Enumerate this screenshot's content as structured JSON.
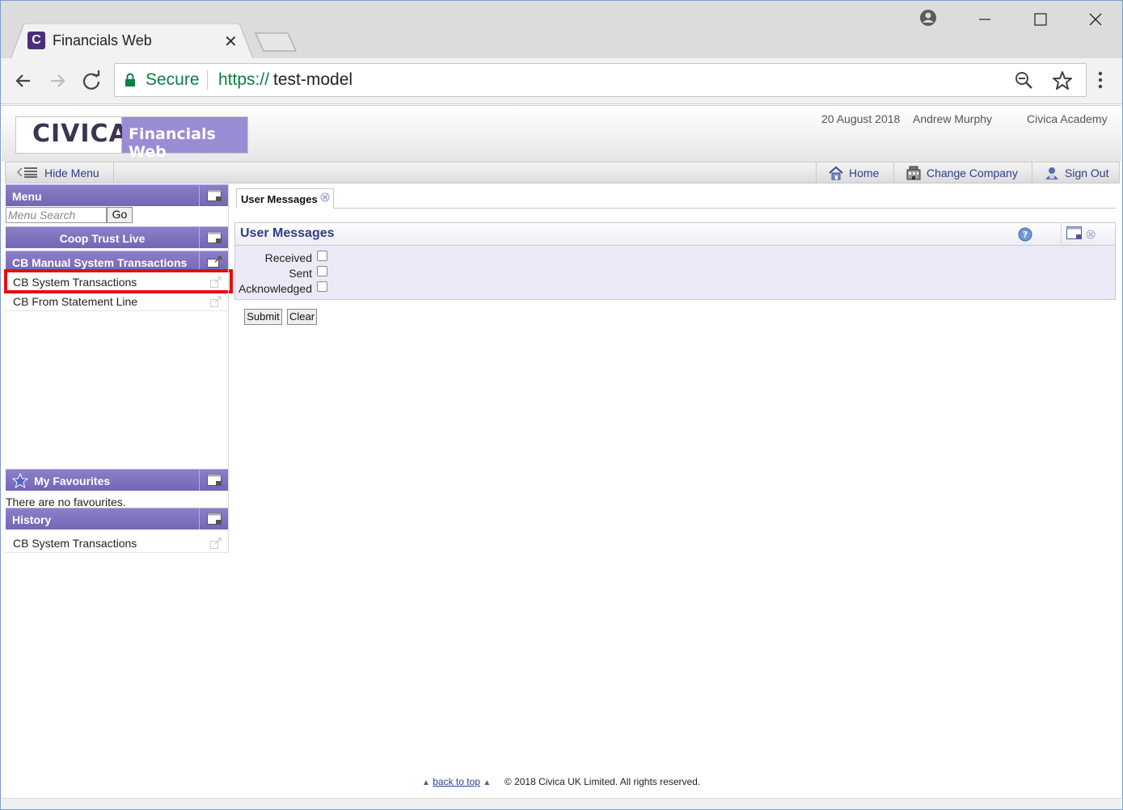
{
  "browser": {
    "tab_title": "Financials Web",
    "tab_favicon": "C",
    "tab_close": "✕",
    "secure_label": "Secure",
    "url_scheme": "https://",
    "url_host": "test-model"
  },
  "header": {
    "logo_text": "CIVICA",
    "product_name": "Financials Web",
    "date": "20 August 2018",
    "user": "Andrew Murphy",
    "organisation": "Civica Academy"
  },
  "nav": {
    "hide_menu": "Hide Menu",
    "home": "Home",
    "change_company": "Change Company",
    "sign_out": "Sign Out"
  },
  "sidebar": {
    "menu_title": "Menu",
    "search_placeholder": "Menu Search",
    "go_label": "Go",
    "company_title": "Coop Trust Live",
    "section_title": "CB Manual System Transactions",
    "items": [
      {
        "label": "CB System Transactions"
      },
      {
        "label": "CB From Statement Line"
      }
    ],
    "favourites_title": "My Favourites",
    "no_favourites": "There are no favourites.",
    "history_title": "History",
    "history_items": [
      {
        "label": "CB System Transactions"
      }
    ]
  },
  "content": {
    "tab_label": "User Messages",
    "panel_title": "User Messages",
    "checkboxes": [
      {
        "label": "Received",
        "checked": false
      },
      {
        "label": "Sent",
        "checked": false
      },
      {
        "label": "Acknowledged",
        "checked": false
      }
    ],
    "submit_label": "Submit",
    "clear_label": "Clear"
  },
  "footer": {
    "back_to_top": "back to top",
    "copyright": "© 2018 Civica UK Limited. All rights reserved."
  },
  "colors": {
    "panel_header": "#7466b4",
    "product_box": "#9a8cd4",
    "link_text": "#2c3e8c",
    "secure_green": "#0b8043",
    "highlight_red": "#e01010"
  }
}
